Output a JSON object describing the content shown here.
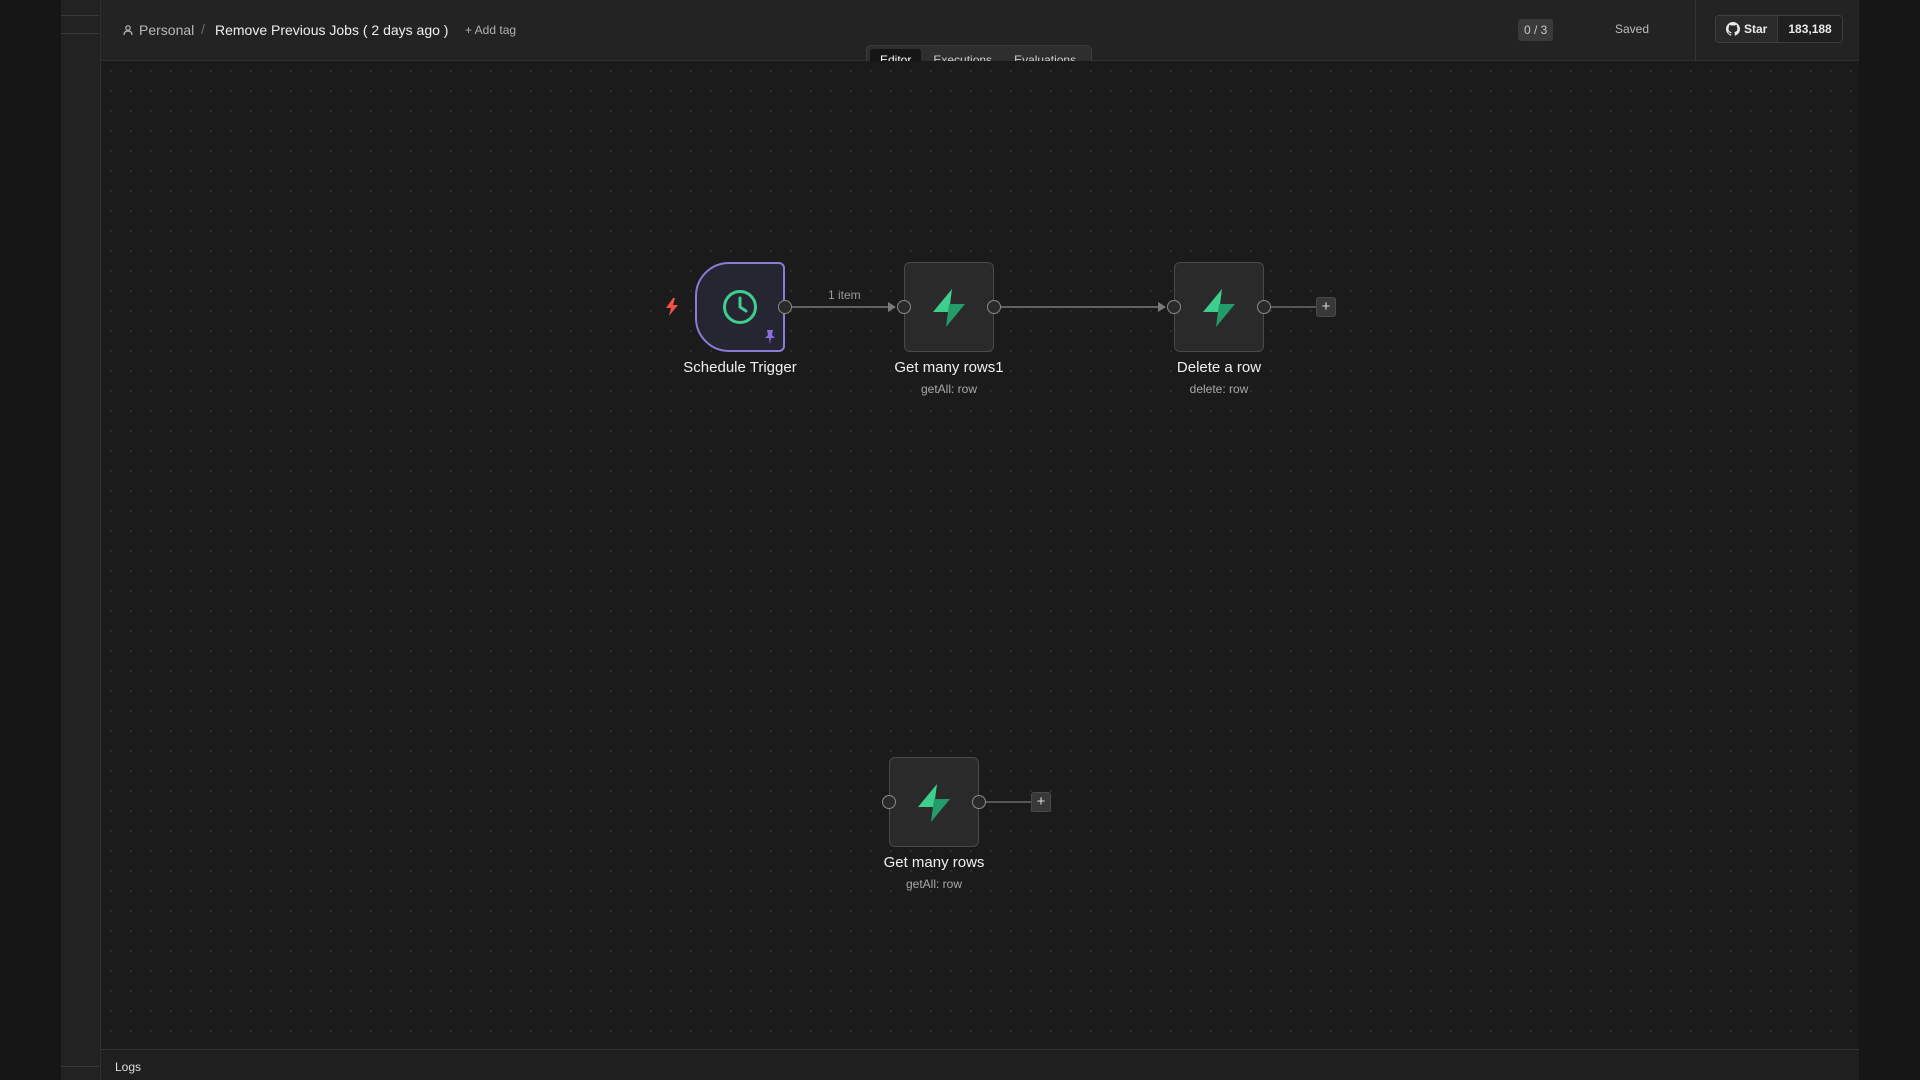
{
  "header": {
    "breadcrumb_project": "Personal",
    "breadcrumb_separator": "/",
    "workflow_title": "Remove Previous Jobs ( 2 days ago )",
    "add_tag_label": "+ Add tag",
    "counter": "0 / 3",
    "status": "Saved",
    "github_star_label": "Star",
    "github_star_count": "183,188"
  },
  "tabs": [
    {
      "label": "Editor",
      "active": true
    },
    {
      "label": "Executions",
      "active": false
    },
    {
      "label": "Evaluations",
      "active": false
    }
  ],
  "nodes": [
    {
      "id": "schedule_trigger",
      "title": "Schedule Trigger",
      "subtitle": "",
      "icon": "clock-icon",
      "is_trigger": true,
      "pinned": true
    },
    {
      "id": "get_many_rows1",
      "title": "Get many rows1",
      "subtitle": "getAll: row",
      "icon": "supabase-icon"
    },
    {
      "id": "delete_a_row",
      "title": "Delete a row",
      "subtitle": "delete: row",
      "icon": "supabase-icon"
    },
    {
      "id": "get_many_rows",
      "title": "Get many rows",
      "subtitle": "getAll: row",
      "icon": "supabase-icon"
    }
  ],
  "edges": [
    {
      "from": "schedule_trigger",
      "to": "get_many_rows1",
      "label": "1 item"
    },
    {
      "from": "get_many_rows1",
      "to": "delete_a_row",
      "label": ""
    }
  ],
  "logs_label": "Logs",
  "colors": {
    "accent_green": "#3ecf8e",
    "trigger_border": "#8c7ad8",
    "trigger_bolt": "#f0524a",
    "pin": "#8a6ee0"
  }
}
